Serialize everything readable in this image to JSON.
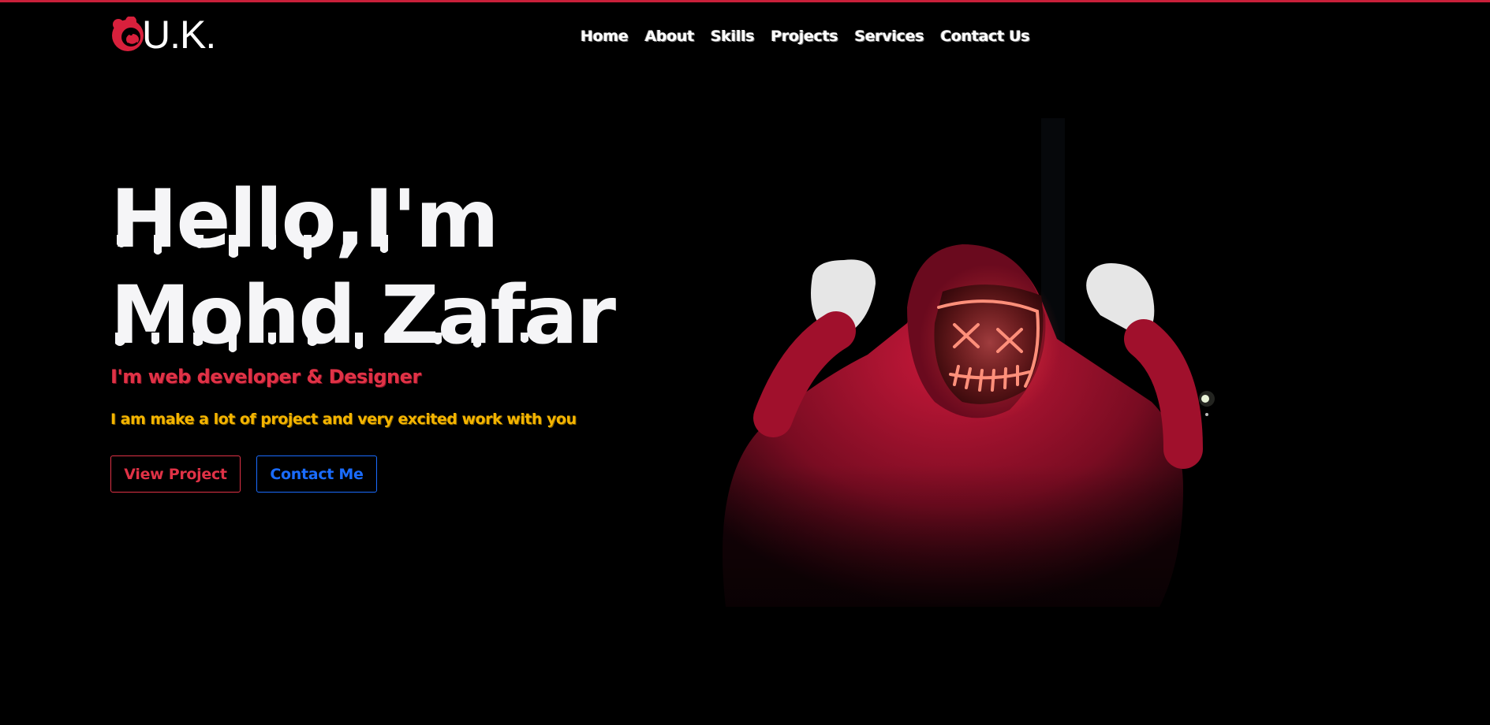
{
  "header": {
    "logo_text": "U.K.",
    "nav": [
      {
        "label": "Home"
      },
      {
        "label": "About"
      },
      {
        "label": "Skills"
      },
      {
        "label": "Projects"
      },
      {
        "label": "Services"
      },
      {
        "label": "Contact Us"
      }
    ]
  },
  "hero": {
    "title_line1": "Hello,I'm",
    "title_line2": "Mohd Zafar",
    "subtitle": "I'm web developer & Designer",
    "tagline": "I am make a lot of project and very excited work with you",
    "primary_button": "View Project",
    "secondary_button": "Contact Me",
    "image_icon": "hooded-figure-neon-mask-image"
  },
  "colors": {
    "accent_red": "#e03246",
    "accent_yellow": "#f4b400",
    "accent_blue": "#1a6cff",
    "background": "#000000"
  }
}
